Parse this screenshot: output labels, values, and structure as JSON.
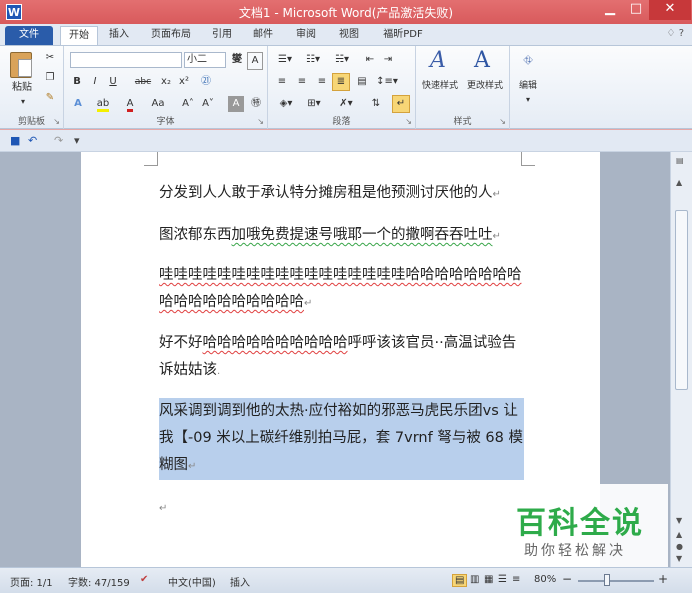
{
  "window": {
    "app_icon": "W",
    "title": "文档1 - Microsoft Word(产品激活失败)",
    "minimize": "▁",
    "maximize": "□",
    "close": "✕"
  },
  "tabs": {
    "file": "文件",
    "items": [
      "开始",
      "插入",
      "页面布局",
      "引用",
      "邮件",
      "审阅",
      "视图",
      "福昕PDF"
    ],
    "active": "开始",
    "help": "♢ ?"
  },
  "ribbon": {
    "clipboard": {
      "label": "剪贴板",
      "paste": "粘贴"
    },
    "font": {
      "label": "字体",
      "font_name": "",
      "font_size": "小二",
      "buttons": [
        "B",
        "I",
        "U",
        "abc",
        "x₂",
        "x²",
        "A",
        "Aa",
        "A˄",
        "A˅",
        "A"
      ]
    },
    "paragraph": {
      "label": "段落"
    },
    "styles": {
      "label": "样式",
      "quick_styles": "快速样式",
      "change_styles": "更改样式"
    },
    "editing": {
      "label": "编辑",
      "edit": "编辑"
    }
  },
  "qat": {
    "save": "■",
    "undo": "↶",
    "redo": "↷",
    "more": "▾"
  },
  "document": {
    "paragraphs": [
      {
        "text": "分发到人人敢于承认特分摊房租是他预测讨厌他的人",
        "mark": "↵"
      },
      {
        "text_plain": "图浓郁东西",
        "text_green": "加哦免费提速号哦耶一个的撒啊吞吞吐吐",
        "mark": "↵"
      },
      {
        "text": "哇哇哇哇哇哇哇哇哇哇哇哇哇哇哇哇哇哈哈哈哈哈哈哈哈哈哈哈哈哈哈哈哈哈哈",
        "mark": "↵"
      },
      {
        "text_plain1": "好不好",
        "text_wavy": "哈哈哈哈哈哈哈哈哈哈",
        "text_plain2": "呼呼该该官员··高温试验告诉姑姑该",
        "mark": "."
      },
      {
        "text": "风采调到调到他的太热·应付裕如的邪恶马虎民乐团vs 让我【-09 米以上碳纤维别拍马屁，套 7vrnf 弩与被 68 模糊图",
        "mark": "↵"
      },
      {
        "text": "",
        "mark": "↵"
      }
    ]
  },
  "watermark": {
    "title": "百科全说",
    "subtitle": "助你轻松解决"
  },
  "status": {
    "page": "页面: 1/1",
    "words": "字数: 47/159",
    "language": "中文(中国)",
    "mode": "插入",
    "zoom": "80%",
    "zoom_minus": "−",
    "zoom_plus": "+"
  }
}
